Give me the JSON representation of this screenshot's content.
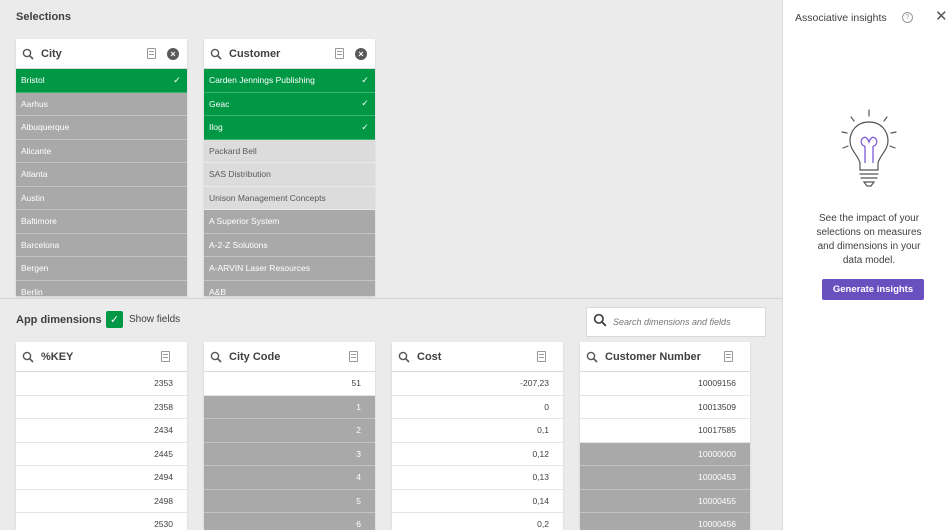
{
  "selections": {
    "title": "Selections",
    "listboxes": [
      {
        "title": "City",
        "rows": [
          {
            "label": "Bristol",
            "state": "selected"
          },
          {
            "label": "Aarhus",
            "state": "excluded"
          },
          {
            "label": "Albuquerque",
            "state": "excluded"
          },
          {
            "label": "Alicante",
            "state": "excluded"
          },
          {
            "label": "Atlanta",
            "state": "excluded"
          },
          {
            "label": "Austin",
            "state": "excluded"
          },
          {
            "label": "Baltimore",
            "state": "excluded"
          },
          {
            "label": "Barcelona",
            "state": "excluded"
          },
          {
            "label": "Bergen",
            "state": "excluded"
          },
          {
            "label": "Berlin",
            "state": "excluded"
          }
        ]
      },
      {
        "title": "Customer",
        "rows": [
          {
            "label": "Carden Jennings Publishing",
            "state": "selected"
          },
          {
            "label": "Geac",
            "state": "selected"
          },
          {
            "label": "Ilog",
            "state": "selected"
          },
          {
            "label": "Packard Bell",
            "state": "alternative"
          },
          {
            "label": "SAS Distribution",
            "state": "alternative"
          },
          {
            "label": "Unison Management Concepts",
            "state": "alternative"
          },
          {
            "label": "A Superior System",
            "state": "excluded"
          },
          {
            "label": "A-2-Z Solutions",
            "state": "excluded"
          },
          {
            "label": "A-ARVIN Laser Resources",
            "state": "excluded"
          },
          {
            "label": "A&B",
            "state": "excluded"
          }
        ]
      }
    ]
  },
  "app_dimensions": {
    "title": "App dimensions",
    "show_fields_label": "Show fields",
    "search_placeholder": "Search dimensions and fields",
    "listboxes": [
      {
        "title": "%KEY",
        "rows": [
          {
            "label": "2353",
            "state": "optional"
          },
          {
            "label": "2358",
            "state": "optional"
          },
          {
            "label": "2434",
            "state": "optional"
          },
          {
            "label": "2445",
            "state": "optional"
          },
          {
            "label": "2494",
            "state": "optional"
          },
          {
            "label": "2498",
            "state": "optional"
          },
          {
            "label": "2530",
            "state": "optional"
          }
        ]
      },
      {
        "title": "City Code",
        "rows": [
          {
            "label": "51",
            "state": "optional"
          },
          {
            "label": "1",
            "state": "excluded"
          },
          {
            "label": "2",
            "state": "excluded"
          },
          {
            "label": "3",
            "state": "excluded"
          },
          {
            "label": "4",
            "state": "excluded"
          },
          {
            "label": "5",
            "state": "excluded"
          },
          {
            "label": "6",
            "state": "excluded"
          }
        ]
      },
      {
        "title": "Cost",
        "rows": [
          {
            "label": "-207,23",
            "state": "optional"
          },
          {
            "label": "0",
            "state": "optional"
          },
          {
            "label": "0,1",
            "state": "optional"
          },
          {
            "label": "0,12",
            "state": "optional"
          },
          {
            "label": "0,13",
            "state": "optional"
          },
          {
            "label": "0,14",
            "state": "optional"
          },
          {
            "label": "0,2",
            "state": "optional"
          }
        ]
      },
      {
        "title": "Customer Number",
        "rows": [
          {
            "label": "10009156",
            "state": "optional"
          },
          {
            "label": "10013509",
            "state": "optional"
          },
          {
            "label": "10017585",
            "state": "optional"
          },
          {
            "label": "10000000",
            "state": "excluded"
          },
          {
            "label": "10000453",
            "state": "excluded"
          },
          {
            "label": "10000455",
            "state": "excluded"
          },
          {
            "label": "10000456",
            "state": "excluded"
          }
        ]
      }
    ]
  },
  "insights": {
    "title": "Associative insights",
    "description": "See the impact of your selections on measures and dimensions in your data model.",
    "button_label": "Generate insights"
  },
  "icons": {
    "search": "search-icon",
    "menu": "list-menu-icon",
    "clear": "clear-selection-icon",
    "check": "checkmark-icon",
    "help": "help-icon",
    "close": "close-icon",
    "bulb": "lightbulb-icon"
  },
  "colors": {
    "selected": "#009845",
    "alternative": "#dcdcdc",
    "excluded": "#a9a9a9",
    "button": "#6a4fbf"
  }
}
